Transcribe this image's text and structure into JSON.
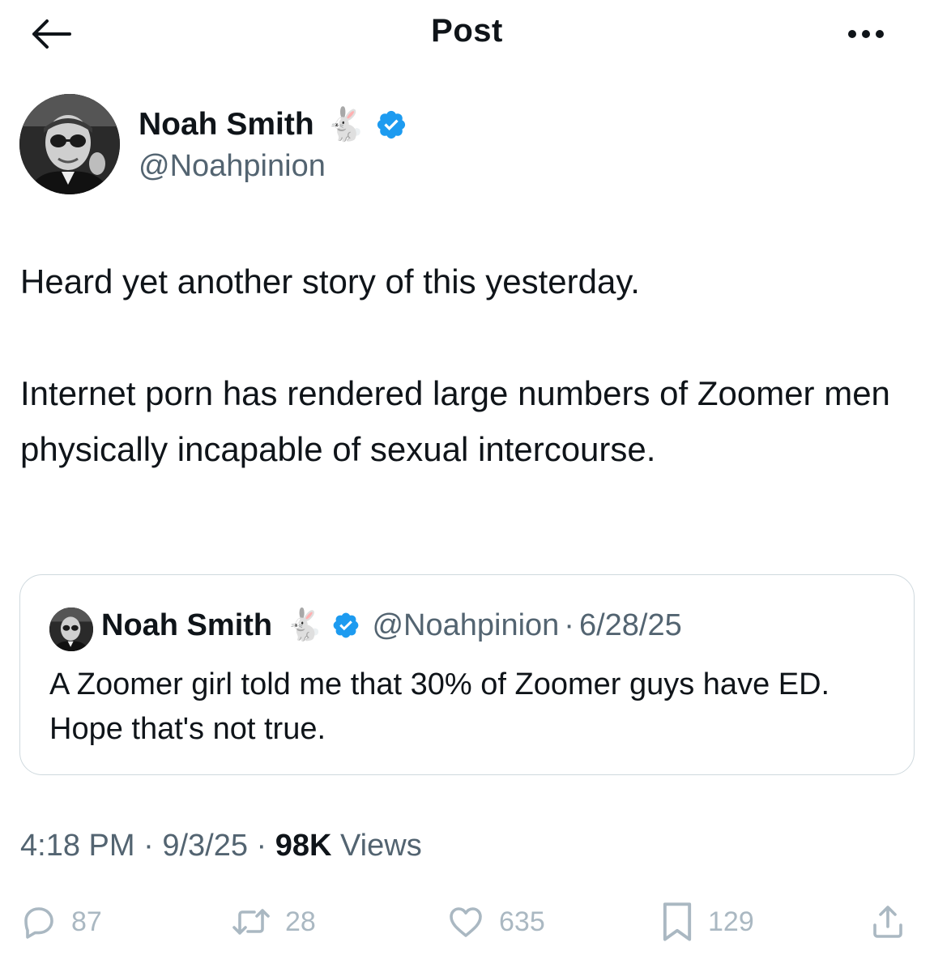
{
  "header": {
    "title": "Post"
  },
  "author": {
    "name": "Noah Smith",
    "emoji": "🐇",
    "handle": "@Noahpinion",
    "verified": true
  },
  "tweet": {
    "paragraphs": [
      "Heard yet another story of this yesterday.",
      "Internet porn has rendered large numbers of Zoomer men physically incapable of sexual intercourse."
    ]
  },
  "quote": {
    "name": "Noah Smith",
    "emoji": "🐇",
    "handle": "@Noahpinion",
    "separator": "·",
    "date": "6/28/25",
    "text": "A Zoomer girl told me that 30% of Zoomer guys have ED. Hope that's not true."
  },
  "meta": {
    "time": "4:18 PM",
    "sep1": " · ",
    "date": "9/3/25",
    "sep2": " · ",
    "views_count": "98K",
    "views_label": " Views"
  },
  "actions": {
    "replies": "87",
    "reposts": "28",
    "likes": "635",
    "bookmarks": "129"
  },
  "colors": {
    "text": "#0f1419",
    "secondary": "#536471",
    "verified": "#1d9bf0",
    "border": "#cfd9de",
    "action_icons": "#aab8c2"
  }
}
